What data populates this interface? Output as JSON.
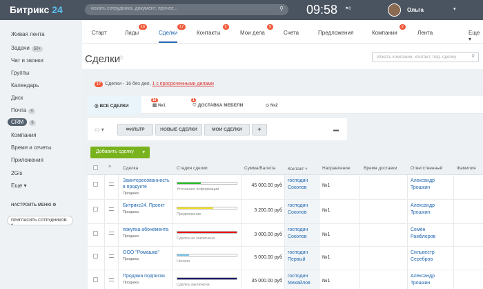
{
  "topbar": {
    "logo_main": "Битрикс",
    "logo_num": "24",
    "search_placeholder": "искать сотрудника, документ, прочее...",
    "clock": "09:58",
    "flag": "0",
    "user": "Ольга"
  },
  "sidebar": {
    "items": [
      {
        "label": "Живая лента"
      },
      {
        "label": "Задачи",
        "count": "50+"
      },
      {
        "label": "Чат и звонки"
      },
      {
        "label": "Группы"
      },
      {
        "label": "Календарь"
      },
      {
        "label": "Диск"
      },
      {
        "label": "Почта",
        "count": "4"
      },
      {
        "label": "CRM",
        "count": "9"
      },
      {
        "label": "Компания"
      },
      {
        "label": "Время и отчеты"
      },
      {
        "label": "Приложения"
      },
      {
        "label": "2Gis"
      },
      {
        "label": "Еще"
      }
    ],
    "settings": "НАСТРОИТЬ МЕНЮ",
    "invite": "ПРИГЛАСИТЬ СОТРУДНИКОВ"
  },
  "tabs": [
    {
      "label": "Старт"
    },
    {
      "label": "Лиды",
      "badge": "16"
    },
    {
      "label": "Сделки",
      "badge": "17"
    },
    {
      "label": "Контакты",
      "badge": "5"
    },
    {
      "label": "Мои дела",
      "badge": "9"
    },
    {
      "label": "Счета"
    },
    {
      "label": "Предложения"
    },
    {
      "label": "Компании",
      "badge": "2"
    },
    {
      "label": "Лента"
    },
    {
      "label": "Еще"
    }
  ],
  "page": {
    "title": "Сделки",
    "search_placeholder": "Искать компании, контакт, под. сделку"
  },
  "info": {
    "count": "17",
    "text": "Сделки - 16 без дел,",
    "overdue": "1 с просроченными делами"
  },
  "filter_tabs": [
    {
      "label": "ВСЕ СДЕЛКИ"
    },
    {
      "label": "№1",
      "badge": "16"
    },
    {
      "label": "ДОСТАВКА МЕБЕЛИ",
      "badge": "1"
    },
    {
      "label": "№2"
    }
  ],
  "toolbar": {
    "filter": "ФИЛЬТР",
    "new_deals": "НОВЫЕ СДЕЛКИ",
    "my_deals": "МОИ СДЕЛКИ",
    "plus": "+"
  },
  "add_button": "Добавить сделку",
  "columns": [
    "Сделка",
    "Стадия сделки",
    "Сумма/Валюта",
    "Контакт",
    "Направление",
    "Время доставки",
    "Ответственный",
    "Фамилия"
  ],
  "rows": [
    {
      "deal": "Заинтересованность в продукте",
      "type": "Продажа",
      "stage": "Уточнение информации",
      "sum": "45 000.00 руб",
      "contact": "господин Соколов",
      "direction": "№1",
      "owner": "Александр Трошкин",
      "progress": 0.4,
      "color": "#22c022"
    },
    {
      "deal": "Битрикс24. Проект",
      "type": "Продажа",
      "stage": "Предложение",
      "sum": "3 200.00 руб",
      "contact": "господин Соколов",
      "direction": "№1",
      "owner": "Александр Трошкин",
      "progress": 0.6,
      "color": "#f2e01a"
    },
    {
      "deal": "покупка абонемента",
      "type": "Продажа",
      "stage": "Сделка не заключена",
      "sum": "3 000.00 руб",
      "contact": "господин Соколов",
      "direction": "№1",
      "owner": "Семён Рамблеров",
      "progress": 1.0,
      "color": "#ee1111"
    },
    {
      "deal": "ООО \"Ромашка\"",
      "type": "Продажа",
      "stage": "Начало",
      "sum": "5 000.00 руб",
      "contact": "господин Первый",
      "direction": "№1",
      "owner": "Сильвестр Серебров",
      "progress": 0.2,
      "color": "#7cc8ee"
    },
    {
      "deal": "Продажа подписки",
      "type": "Продажа",
      "stage": "Сделка заключена",
      "sum": "35 000.00 руб",
      "contact": "господин Михайлов",
      "direction": "№1",
      "owner": "Александр Трошкин",
      "progress": 1.0,
      "color": "#1a1a6e"
    }
  ]
}
